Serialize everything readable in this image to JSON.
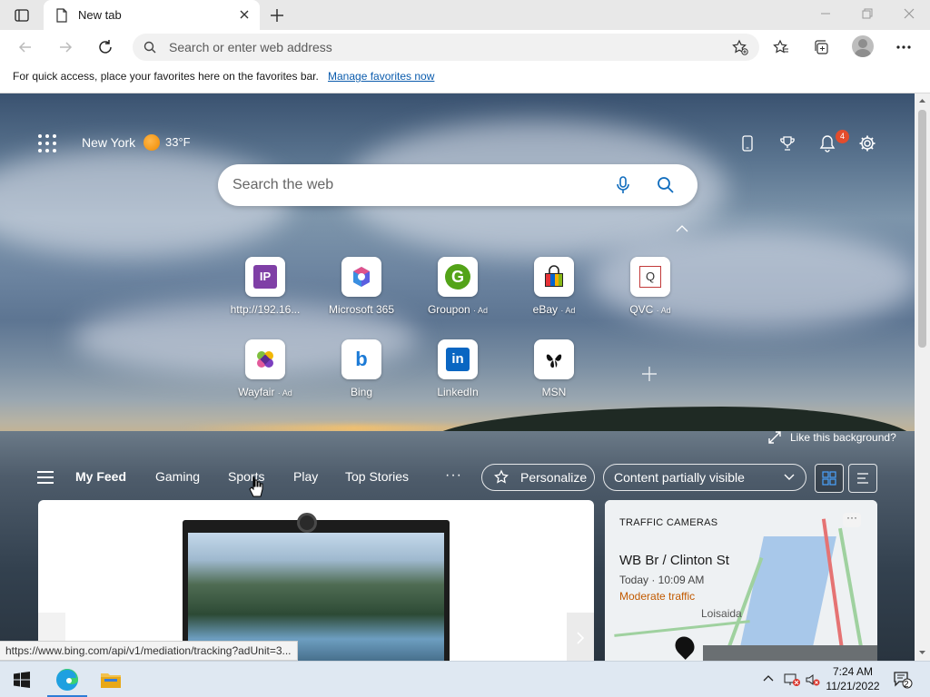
{
  "browser": {
    "tab_title": "New tab",
    "address_placeholder": "Search or enter web address"
  },
  "favorites_bar": {
    "message": "For quick access, place your favorites here on the favorites bar.",
    "link": "Manage favorites now"
  },
  "header": {
    "city": "New York",
    "temperature": "33°F",
    "notification_count": "4"
  },
  "search": {
    "placeholder": "Search the web"
  },
  "quick_links": [
    {
      "label": "http://192.16...",
      "ad": ""
    },
    {
      "label": "Microsoft 365",
      "ad": ""
    },
    {
      "label": "Groupon",
      "ad": "· Ad"
    },
    {
      "label": "eBay",
      "ad": "· Ad"
    },
    {
      "label": "QVC",
      "ad": "· Ad"
    },
    {
      "label": "Wayfair",
      "ad": "· Ad"
    },
    {
      "label": "Bing",
      "ad": ""
    },
    {
      "label": "LinkedIn",
      "ad": ""
    },
    {
      "label": "MSN",
      "ad": ""
    }
  ],
  "background": {
    "like_text": "Like this background?"
  },
  "feed": {
    "tabs": [
      "My Feed",
      "Gaming",
      "Sports",
      "Play",
      "Top Stories"
    ],
    "more": "···",
    "personalize": "Personalize",
    "content_visibility": "Content partially visible"
  },
  "traffic_card": {
    "heading": "TRAFFIC CAMERAS",
    "location": "WB Br / Clinton St",
    "time": "Today · 10:09 AM",
    "status": "Moderate traffic",
    "status_color": "#c25a00",
    "map_label": "Loisaida"
  },
  "status_url": "https://www.bing.com/api/v1/mediation/tracking?adUnit=3...",
  "taskbar": {
    "time": "7:24 AM",
    "date": "11/21/2022",
    "notification_count": "2"
  }
}
